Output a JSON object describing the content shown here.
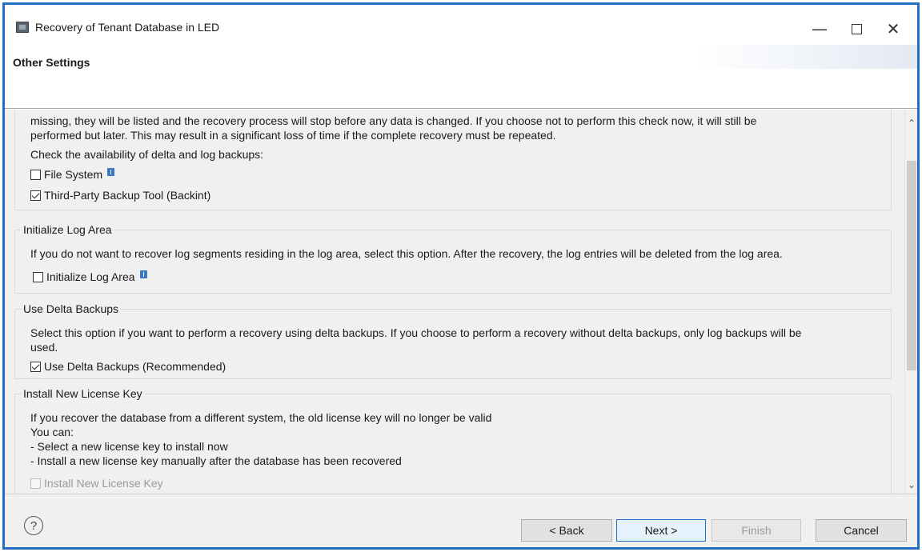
{
  "window": {
    "title": "Recovery of Tenant Database in LED"
  },
  "header": {
    "title": "Other Settings"
  },
  "check_group": {
    "text": "missing, they will be listed and the recovery process will stop before any data is changed. If you choose not to perform this check now, it will still be\nperformed but later. This may result in a significant loss of time if the complete recovery must be repeated.",
    "prompt": "Check the availability of delta and log backups:",
    "file_system_label": "File System",
    "file_system_checked": false,
    "backint_label": "Third-Party Backup Tool (Backint)",
    "backint_checked": true
  },
  "init_log": {
    "legend": "Initialize Log Area",
    "text": "If you do not want to recover log segments residing in the log area, select this option. After the recovery, the log entries will be deleted from the log area.",
    "checkbox_label": "Initialize Log Area",
    "checked": false
  },
  "delta_backups": {
    "legend": "Use Delta Backups",
    "text": "Select this option if you want to perform a recovery using delta backups. If you choose to perform a recovery without delta backups, only log backups will be\nused.",
    "checkbox_label": "Use Delta Backups (Recommended)",
    "checked": true
  },
  "license": {
    "legend": "Install New License Key",
    "text": "If you recover the database from a different system, the old license key will no longer be valid\nYou can:\n- Select a new license key to install now\n- Install a new license key manually after the database has been recovered",
    "checkbox_label": "Install New License Key",
    "checked": false,
    "enabled": false
  },
  "footer": {
    "back_label": "< Back",
    "next_label": "Next >",
    "finish_label": "Finish",
    "cancel_label": "Cancel"
  },
  "icons": {
    "app": "app-icon",
    "help": "help-icon",
    "info": "info-icon"
  },
  "colors": {
    "window_border": "#1f6fc5",
    "info_icon": "#3a78c2",
    "default_button_border": "#1f6fc5"
  }
}
